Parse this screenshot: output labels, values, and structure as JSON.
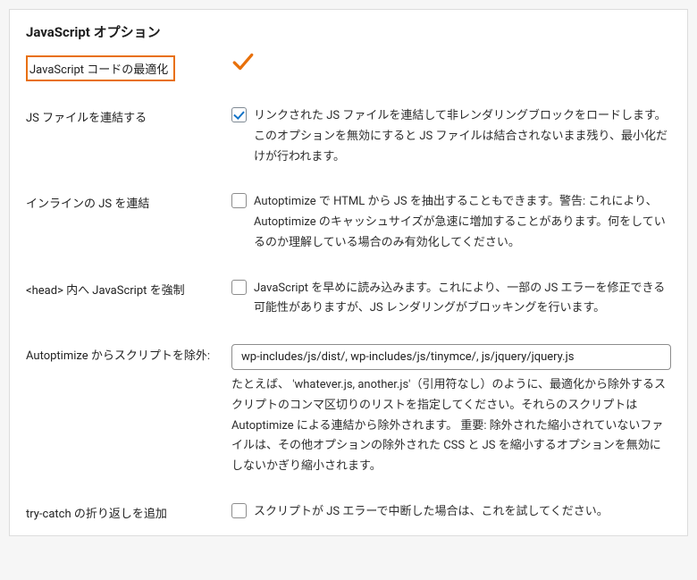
{
  "section_title": "JavaScript オプション",
  "fields": {
    "optimize": {
      "label": "JavaScript コードの最適化"
    },
    "aggregate": {
      "label": "JS ファイルを連結する",
      "desc": "リンクされた JS ファイルを連結して非レンダリングブロックをロードします。このオプションを無効にすると JS ファイルは結合されないまま残り、最小化だけが行われます。"
    },
    "inline": {
      "label": "インラインの JS を連結",
      "desc": "Autoptimize で HTML から JS を抽出することもできます。警告: これにより、Autoptimize のキャッシュサイズが急速に増加することがあります。何をしているのか理解している場合のみ有効化してください。"
    },
    "forcehead": {
      "label": "<head> 内へ JavaScript を強制",
      "desc": "JavaScript を早めに読み込みます。これにより、一部の JS エラーを修正できる可能性がありますが、JS レンダリングがブロッキングを行います。"
    },
    "exclude": {
      "label": "Autoptimize からスクリプトを除外:",
      "value": "wp-includes/js/dist/, wp-includes/js/tinymce/, js/jquery/jquery.js",
      "desc": "たとえば、 'whatever.js, another.js'（引用符なし）のように、最適化から除外するスクリプトのコンマ区切りのリストを指定してください。それらのスクリプトは Autoptimize による連結から除外されます。 重要: 除外された縮小されていないファイルは、その他オプションの除外された CSS と JS を縮小するオプションを無効にしないかぎり縮小されます。"
    },
    "trycatch": {
      "label": "try-catch の折り返しを追加",
      "desc": "スクリプトが JS エラーで中断した場合は、これを試してください。"
    }
  }
}
